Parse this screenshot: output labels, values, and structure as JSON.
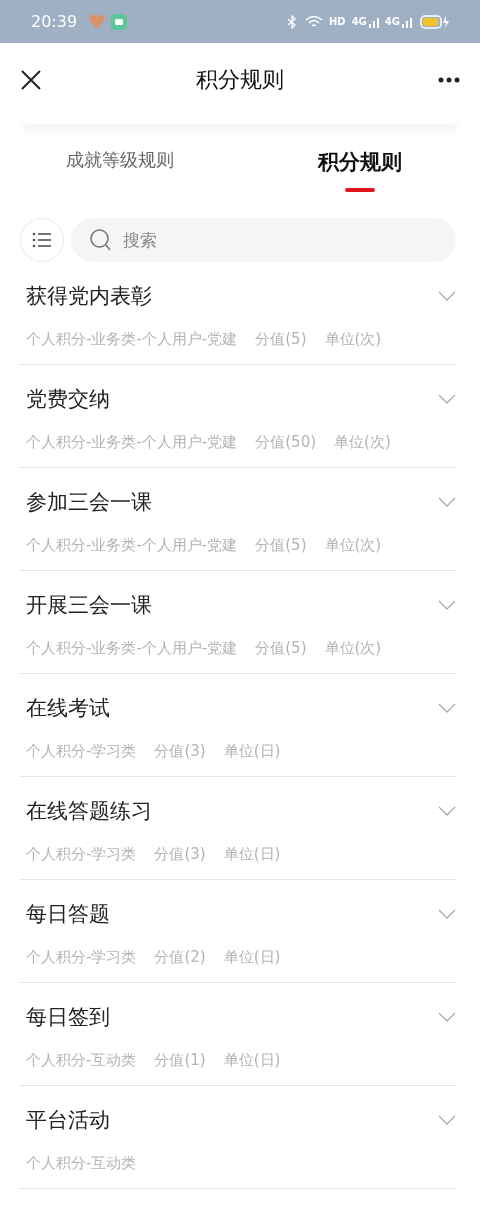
{
  "status_bar": {
    "time": "20:39",
    "network_labels": [
      "HD",
      "4G",
      "4G"
    ]
  },
  "header": {
    "title": "积分规则"
  },
  "tabs": [
    {
      "label": "成就等级规则",
      "selected": false
    },
    {
      "label": "积分规则",
      "selected": true
    }
  ],
  "search": {
    "placeholder": "搜索"
  },
  "rules": [
    {
      "title": "获得党内表彰",
      "details": [
        "个人积分-业务类-个人用户-党建",
        "分值(5)",
        "单位(次)"
      ]
    },
    {
      "title": "党费交纳",
      "details": [
        "个人积分-业务类-个人用户-党建",
        "分值(50)",
        "单位(次)"
      ]
    },
    {
      "title": "参加三会一课",
      "details": [
        "个人积分-业务类-个人用户-党建",
        "分值(5)",
        "单位(次)"
      ]
    },
    {
      "title": "开展三会一课",
      "details": [
        "个人积分-业务类-个人用户-党建",
        "分值(5)",
        "单位(次)"
      ]
    },
    {
      "title": "在线考试",
      "details": [
        "个人积分-学习类",
        "分值(3)",
        "单位(日)"
      ]
    },
    {
      "title": "在线答题练习",
      "details": [
        "个人积分-学习类",
        "分值(3)",
        "单位(日)"
      ]
    },
    {
      "title": "每日答题",
      "details": [
        "个人积分-学习类",
        "分值(2)",
        "单位(日)"
      ]
    },
    {
      "title": "每日签到",
      "details": [
        "个人积分-互动类",
        "分值(1)",
        "单位(日)"
      ]
    },
    {
      "title": "平台活动",
      "details": [
        "个人积分-互动类"
      ]
    }
  ]
}
